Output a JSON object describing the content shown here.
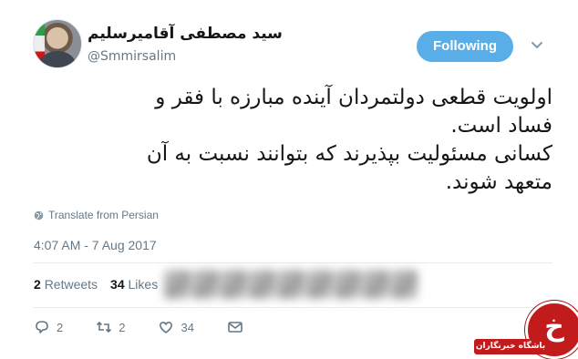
{
  "user": {
    "display_name": "سید مصطفی آقامیرسلیم",
    "handle": "@Smmirsalim"
  },
  "follow_button": {
    "label": "Following",
    "color": "#5aaee8"
  },
  "tweet": {
    "lines": [
      "اولویت قطعی دولتمردان آینده مبارزه با فقر و",
      "فساد است.",
      "کسانی مسئولیت بپذیرند که بتوانند نسبت به آن",
      "متعهد شوند."
    ],
    "translate_label": "Translate from Persian",
    "timestamp": "4:07 AM - 7 Aug 2017"
  },
  "stats": {
    "retweets_count": "2",
    "retweets_label": "Retweets",
    "likes_count": "34",
    "likes_label": "Likes"
  },
  "actions": {
    "replies": "2",
    "retweets": "2",
    "likes": "34"
  },
  "icons": [
    "globe-icon",
    "chevron-down-icon",
    "reply-icon",
    "retweet-icon",
    "like-icon",
    "message-icon"
  ],
  "watermark": {
    "glyph": "خ",
    "text": "باشگاه خبرنگاران",
    "color": "#c21b1b"
  }
}
